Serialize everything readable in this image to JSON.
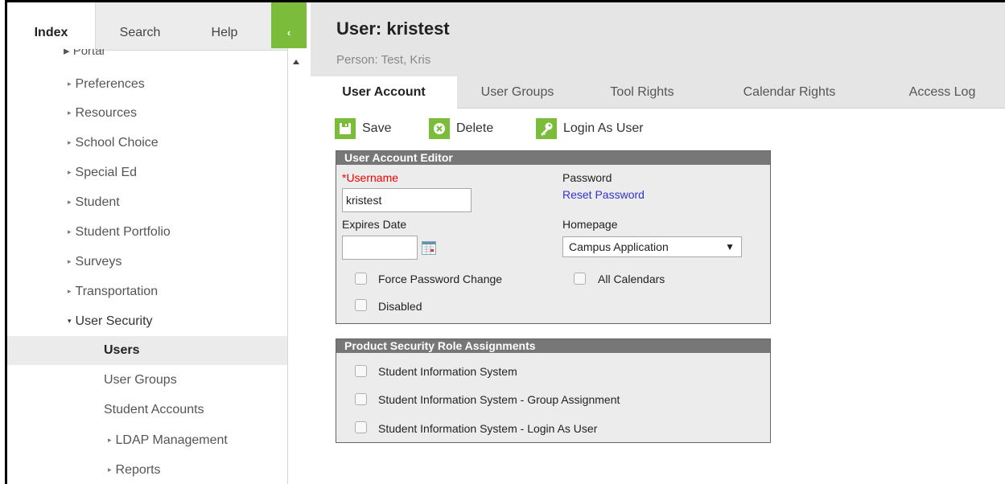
{
  "nav": {
    "tabs": [
      "Index",
      "Search",
      "Help"
    ],
    "collapse_glyph": "‹",
    "portal_partial": "Portal",
    "items": [
      {
        "label": "Preferences",
        "arrow": "▸"
      },
      {
        "label": "Resources",
        "arrow": "▸"
      },
      {
        "label": "School Choice",
        "arrow": "▸"
      },
      {
        "label": "Special Ed",
        "arrow": "▸"
      },
      {
        "label": "Student",
        "arrow": "▸"
      },
      {
        "label": "Student Portfolio",
        "arrow": "▸"
      },
      {
        "label": "Surveys",
        "arrow": "▸"
      },
      {
        "label": "Transportation",
        "arrow": "▸"
      },
      {
        "label": "User Security",
        "arrow": "▾"
      }
    ],
    "sub_items": [
      {
        "label": "Users",
        "selected": true
      },
      {
        "label": "User Groups"
      },
      {
        "label": "Student Accounts"
      },
      {
        "label": "LDAP Management",
        "arrow": "▸"
      },
      {
        "label": "Reports",
        "arrow": "▸"
      }
    ]
  },
  "header": {
    "title": "User: kristest",
    "subtitle": "Person: Test, Kris"
  },
  "tabs": [
    "User Account",
    "User Groups",
    "Tool Rights",
    "Calendar Rights",
    "Access Log"
  ],
  "toolbar": {
    "save": "Save",
    "delete": "Delete",
    "login_as": "Login As User"
  },
  "editor": {
    "title": "User Account Editor",
    "username_label": "*Username",
    "username_value": "kristest",
    "password_label": "Password",
    "reset_password": "Reset Password",
    "expires_label": "Expires Date",
    "expires_value": "",
    "homepage_label": "Homepage",
    "homepage_value": "Campus Application",
    "force_password_change": "Force Password Change",
    "all_calendars": "All Calendars",
    "disabled": "Disabled"
  },
  "roles": {
    "title": "Product Security Role Assignments",
    "items": [
      "Student Information System",
      "Student Information System - Group Assignment",
      "Student Information System - Login As User"
    ]
  },
  "colors": {
    "accent": "#7bbd3b",
    "panel_header": "#777777",
    "link": "#3333cc",
    "required": "#ee0000"
  }
}
